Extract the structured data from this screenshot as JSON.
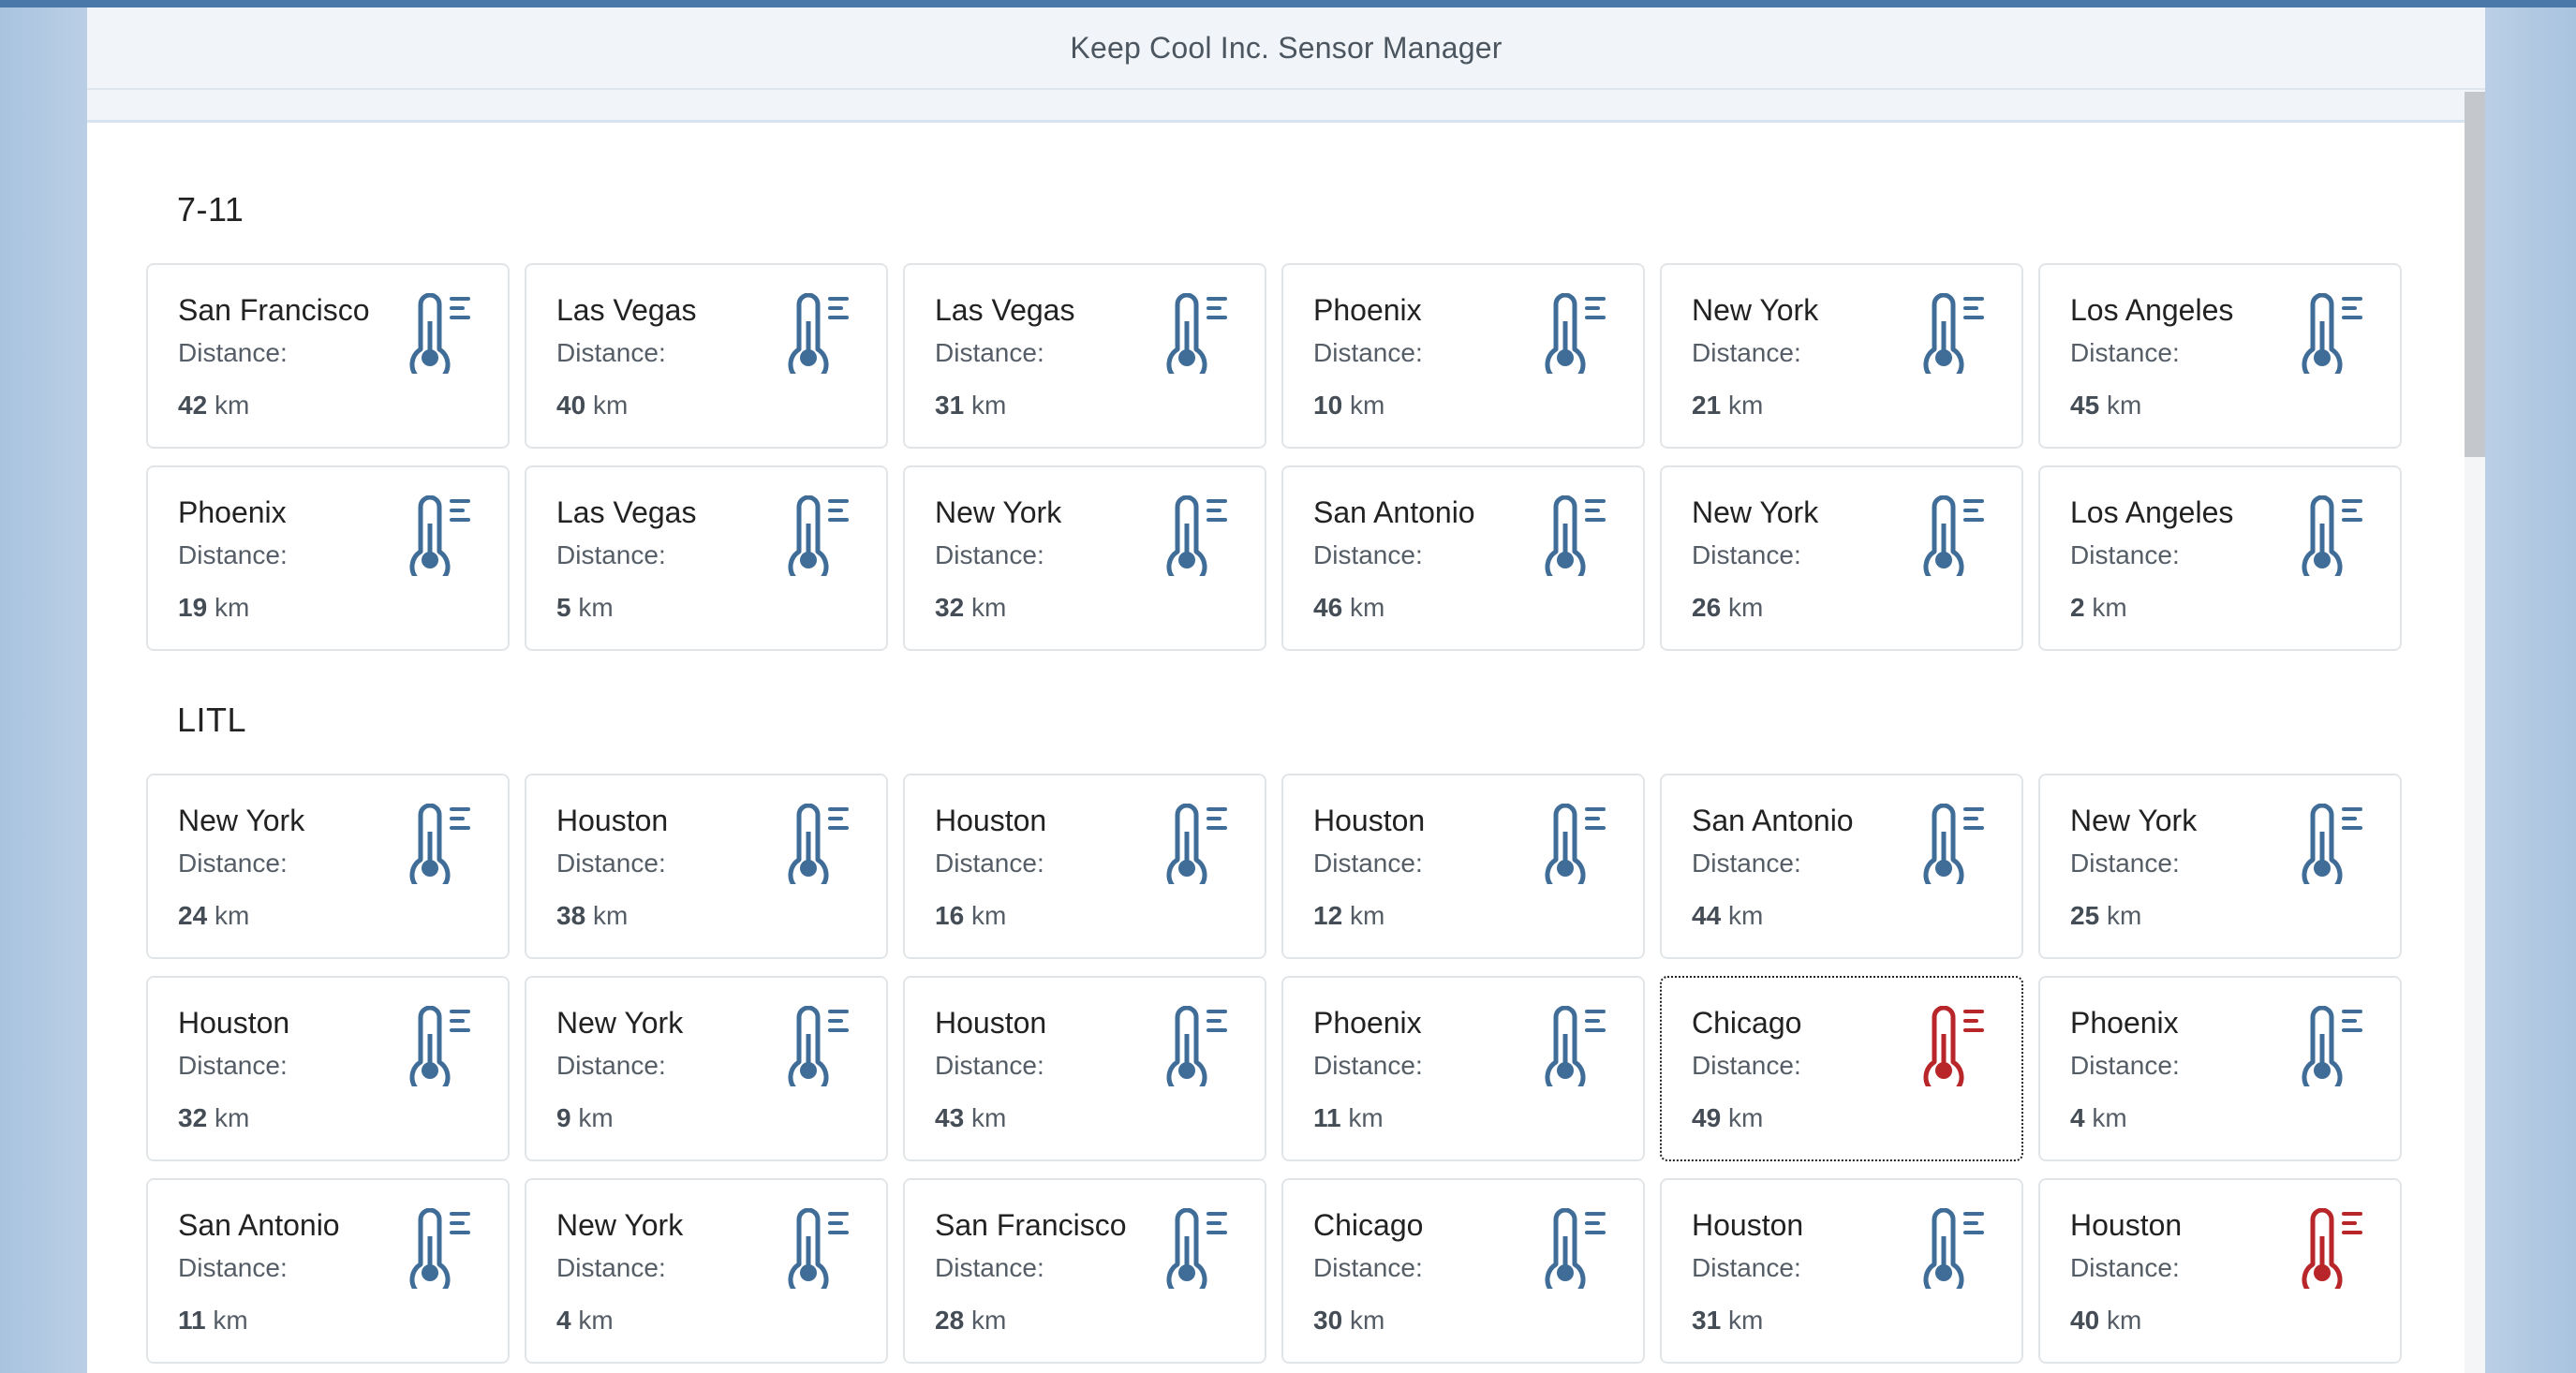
{
  "app": {
    "title": "Keep Cool Inc. Sensor Manager"
  },
  "colors": {
    "normal_icon": "#3f6d98",
    "alert_icon": "#b8262a"
  },
  "unit": "km",
  "distance_label": "Distance:",
  "icon_name": "thermometer-icon",
  "sections": [
    {
      "title": "7-11",
      "rows": [
        [
          {
            "name": "San Francisco",
            "distance": "42",
            "status": "normal"
          },
          {
            "name": "Las Vegas",
            "distance": "40",
            "status": "normal"
          },
          {
            "name": "Las Vegas",
            "distance": "31",
            "status": "normal"
          },
          {
            "name": "Phoenix",
            "distance": "10",
            "status": "normal"
          },
          {
            "name": "New York",
            "distance": "21",
            "status": "normal"
          },
          {
            "name": "Los Angeles",
            "distance": "45",
            "status": "normal"
          }
        ],
        [
          {
            "name": "Phoenix",
            "distance": "19",
            "status": "normal"
          },
          {
            "name": "Las Vegas",
            "distance": "5",
            "status": "normal"
          },
          {
            "name": "New York",
            "distance": "32",
            "status": "normal"
          },
          {
            "name": "San Antonio",
            "distance": "46",
            "status": "normal"
          },
          {
            "name": "New York",
            "distance": "26",
            "status": "normal"
          },
          {
            "name": "Los Angeles",
            "distance": "2",
            "status": "normal"
          }
        ]
      ]
    },
    {
      "title": "LITL",
      "rows": [
        [
          {
            "name": "New York",
            "distance": "24",
            "status": "normal"
          },
          {
            "name": "Houston",
            "distance": "38",
            "status": "normal"
          },
          {
            "name": "Houston",
            "distance": "16",
            "status": "normal"
          },
          {
            "name": "Houston",
            "distance": "12",
            "status": "normal"
          },
          {
            "name": "San Antonio",
            "distance": "44",
            "status": "normal"
          },
          {
            "name": "New York",
            "distance": "25",
            "status": "normal"
          }
        ],
        [
          {
            "name": "Houston",
            "distance": "32",
            "status": "normal"
          },
          {
            "name": "New York",
            "distance": "9",
            "status": "normal"
          },
          {
            "name": "Houston",
            "distance": "43",
            "status": "normal"
          },
          {
            "name": "Phoenix",
            "distance": "11",
            "status": "normal"
          },
          {
            "name": "Chicago",
            "distance": "49",
            "status": "alert",
            "focused": true
          },
          {
            "name": "Phoenix",
            "distance": "4",
            "status": "normal"
          }
        ],
        [
          {
            "name": "San Antonio",
            "distance": "11",
            "status": "normal"
          },
          {
            "name": "New York",
            "distance": "4",
            "status": "normal"
          },
          {
            "name": "San Francisco",
            "distance": "28",
            "status": "normal"
          },
          {
            "name": "Chicago",
            "distance": "30",
            "status": "normal"
          },
          {
            "name": "Houston",
            "distance": "31",
            "status": "normal"
          },
          {
            "name": "Houston",
            "distance": "40",
            "status": "alert"
          }
        ]
      ]
    }
  ]
}
